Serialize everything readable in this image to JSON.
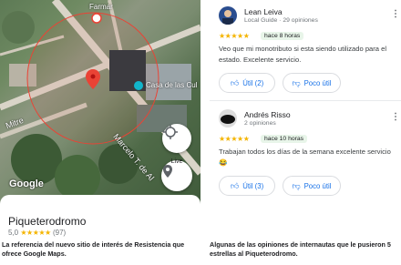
{
  "map": {
    "poi_top": "Farmar",
    "poi_right": "Casa de las Cul",
    "street_left": "Mitre",
    "street_diag": "Marcelo T. de Al",
    "google_logo": "Google",
    "live_label": "Live"
  },
  "place": {
    "name": "Piqueterodromo",
    "rating": "5,0",
    "stars": "★★★★★",
    "count": "(97)"
  },
  "captions": {
    "left": "La referencia del nuevo sitio de interés de Resistencia que ofrece Google Maps.",
    "right": "Algunas de las opiniones de internautas que le pusieron 5 estrellas al Piqueterodromo."
  },
  "reviews": [
    {
      "name": "Lean Leiva",
      "meta": "Local Guide · 29 opiniones",
      "stars": "★★★★★",
      "ago": "hace 8 horas",
      "text": "Veo que mi monotributo si esta siendo utilizado para el estado. Excelente servicio.",
      "useful": "Útil (2)",
      "not_useful": "Poco útil"
    },
    {
      "name": "Andrés Risso",
      "meta": "2 opiniones",
      "stars": "★★★★★",
      "ago": "hace 10 horas",
      "text": "Trabajan todos los días de la semana excelente servicio 😂",
      "useful": "Útil (3)",
      "not_useful": "Poco útil"
    }
  ],
  "colors": {
    "star": "#f4b400",
    "link": "#1a73e8",
    "pin": "#ea4335"
  },
  "icons": [
    "location-pin-icon",
    "museum-icon",
    "recenter-icon",
    "live-view-icon",
    "thumb-up-icon",
    "thumb-down-icon",
    "more-vert-icon"
  ]
}
